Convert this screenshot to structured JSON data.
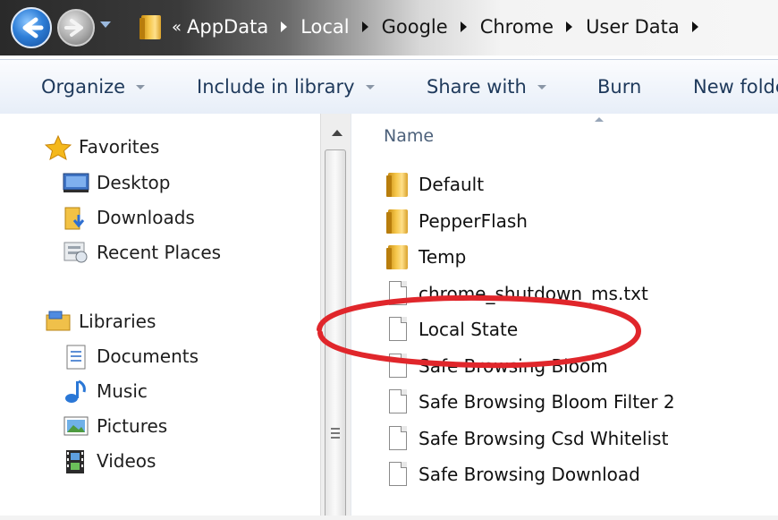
{
  "address_bar": {
    "overflow_chevron": "«",
    "breadcrumbs": [
      "AppData",
      "Local",
      "Google",
      "Chrome",
      "User Data"
    ]
  },
  "toolbar": {
    "organize": "Organize",
    "include_in_library": "Include in library",
    "share_with": "Share with",
    "burn": "Burn",
    "new_folder": "New folde"
  },
  "nav": {
    "favorites": {
      "label": "Favorites",
      "items": [
        "Desktop",
        "Downloads",
        "Recent Places"
      ]
    },
    "libraries": {
      "label": "Libraries",
      "items": [
        "Documents",
        "Music",
        "Pictures",
        "Videos"
      ]
    }
  },
  "file_list": {
    "column_name": "Name",
    "items": [
      {
        "name": "Default",
        "type": "folder"
      },
      {
        "name": "PepperFlash",
        "type": "folder"
      },
      {
        "name": "Temp",
        "type": "folder"
      },
      {
        "name": "chrome_shutdown_ms.txt",
        "type": "file"
      },
      {
        "name": "Local State",
        "type": "file"
      },
      {
        "name": "Safe Browsing Bloom",
        "type": "file"
      },
      {
        "name": "Safe Browsing Bloom Filter 2",
        "type": "file"
      },
      {
        "name": "Safe Browsing Csd Whitelist",
        "type": "file"
      },
      {
        "name": "Safe Browsing Download",
        "type": "file"
      }
    ]
  },
  "annotation": {
    "highlighted_item": "Local State",
    "color": "#e0262b"
  }
}
